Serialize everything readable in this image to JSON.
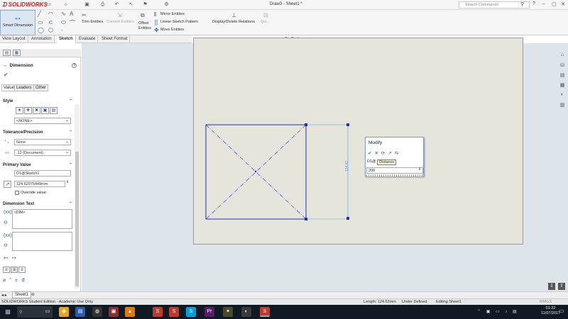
{
  "app": {
    "brand": "SOLIDWORKS",
    "doc_title": "Draw3 - Sheet1 *",
    "search_placeholder": "Search Commands"
  },
  "ribbon": {
    "smart_dimension": "Smart Dimension",
    "trim_entities": "Trim Entities",
    "convert_entities": "Convert Entities",
    "offset_entities": "Offset Entities",
    "mirror_entities": "Mirror Entities",
    "linear_sketch_pattern": "Linear Sketch Pattern",
    "move_entities": "Move Entities",
    "display_delete_relations": "Display/Delete Relations",
    "quick_snaps": "Qui..."
  },
  "cm_tabs": [
    "View Layout",
    "Annotation",
    "Sketch",
    "Evaluate",
    "Sheet Format"
  ],
  "cm_active": "Sketch",
  "property_manager": {
    "title": "Dimension",
    "tabs": [
      "Value",
      "Leaders",
      "Other"
    ],
    "style": {
      "header": "Style",
      "selected": "<NONE>"
    },
    "tolerance": {
      "header": "Tolerance/Precision",
      "tolerance_type": "None",
      "precision": ".12 (Document)"
    },
    "primary_value": {
      "header": "Primary Value",
      "name": "D1@Sketch1",
      "value": "124.62075449mm",
      "override_label": "Override value:"
    },
    "dimension_text": {
      "header": "Dimension Text",
      "text": "<DIM>"
    }
  },
  "drawing": {
    "dimension_text": "124.62"
  },
  "modify_dialog": {
    "title": "Modify",
    "name_prefix": "D1@",
    "tooltip": "Distance",
    "value": "200"
  },
  "sheet_tab": "Sheet1",
  "status": {
    "left": "SOLIDWORKS Student Edition - Academic Use Only",
    "length": "Length: 124.62mm",
    "state": "Under Defined",
    "editing": "Editing Sheet1",
    "units": "MMGS"
  },
  "taskbar": {
    "time": "01:22",
    "date": "11/07/2017"
  },
  "colors": {
    "accent": "#2a5ba8",
    "sketch_line": "#1f2fb8",
    "sheet": "#e6e5dc",
    "brand": "#d71920"
  }
}
